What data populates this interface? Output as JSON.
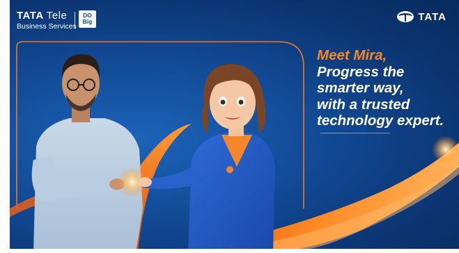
{
  "brand": {
    "tts_word": "TATA",
    "tts_tele": "Tele",
    "tts_sub": "Business Services",
    "dobig_line1": "DO",
    "dobig_line2": "Big",
    "tata_word": "TATA"
  },
  "headline": {
    "line1": "Meet Mira,",
    "line2": "Progress the",
    "line3": "smarter way,",
    "line4": "with a trusted",
    "line5": "technology expert."
  },
  "colors": {
    "accent_orange": "#f6862b",
    "background_blue": "#124a96",
    "jacket_blue": "#2159c4"
  },
  "icons": [
    "tata-tele-logo",
    "do-big-badge",
    "tata-emblem-icon"
  ]
}
